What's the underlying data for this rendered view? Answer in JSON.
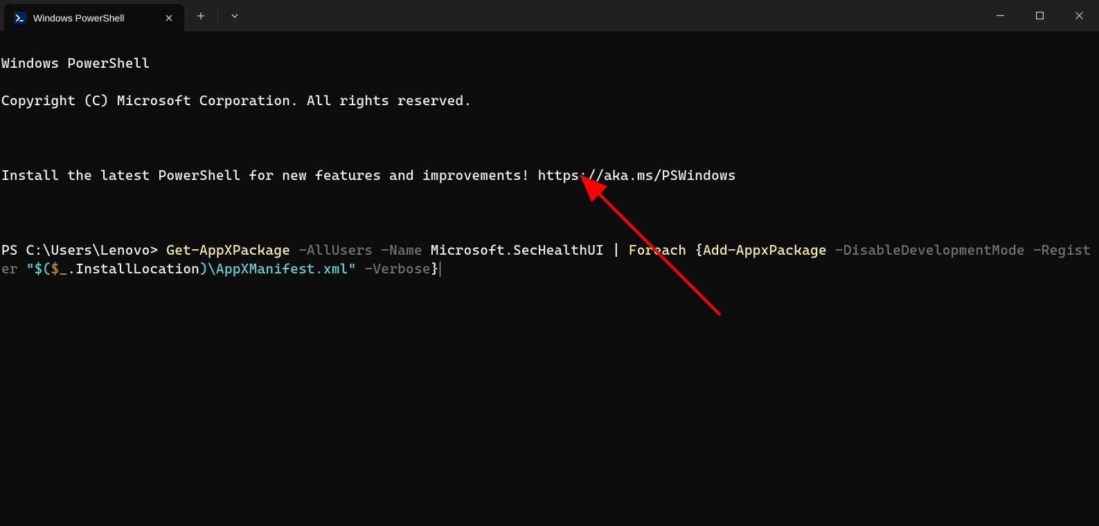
{
  "tab": {
    "title": "Windows PowerShell",
    "icon_text": ">_"
  },
  "header": {
    "line1": "Windows PowerShell",
    "line2": "Copyright (C) Microsoft Corporation. All rights reserved.",
    "install_msg": "Install the latest PowerShell for new features and improvements! https://aka.ms/PSWindows"
  },
  "prompt": {
    "prefix": "PS C:\\Users\\Lenovo> ",
    "command": {
      "t1": "Get-AppXPackage",
      "t2": " -AllUsers",
      "t3": " -Name",
      "t4": " Microsoft.SecHealthUI ",
      "t5": "|",
      "t6": " Foreach ",
      "t7": "{",
      "t8": "Add-AppxPackage",
      "t9": " -DisableDevelopmentMode",
      "t10": " -Register",
      "t11": " \"$(",
      "t12": "$_",
      "t13": ".InstallLocation",
      "t14": ")",
      "t15": "\\AppXManifest.xml\"",
      "t16": " -Verbose",
      "t17": "}"
    }
  }
}
